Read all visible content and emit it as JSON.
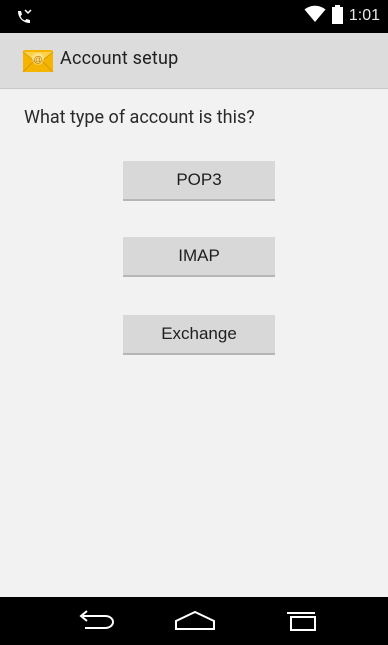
{
  "status_bar": {
    "time": "1:01",
    "icons": [
      "missed-call-icon",
      "wifi-icon",
      "battery-icon"
    ]
  },
  "action_bar": {
    "title": "Account setup",
    "app_icon": "email-envelope-icon"
  },
  "content": {
    "question": "What type of account is this?",
    "buttons": [
      {
        "label": "POP3"
      },
      {
        "label": "IMAP"
      },
      {
        "label": "Exchange"
      }
    ]
  },
  "nav_bar": {
    "icons": [
      "back-icon",
      "home-icon",
      "recents-icon"
    ]
  },
  "colors": {
    "status_bar_bg": "#000000",
    "action_bar_bg": "#dcdcdc",
    "screen_bg": "#f2f2f2",
    "button_bg": "#d8d8d8",
    "icon_accent": "#f4b400"
  }
}
